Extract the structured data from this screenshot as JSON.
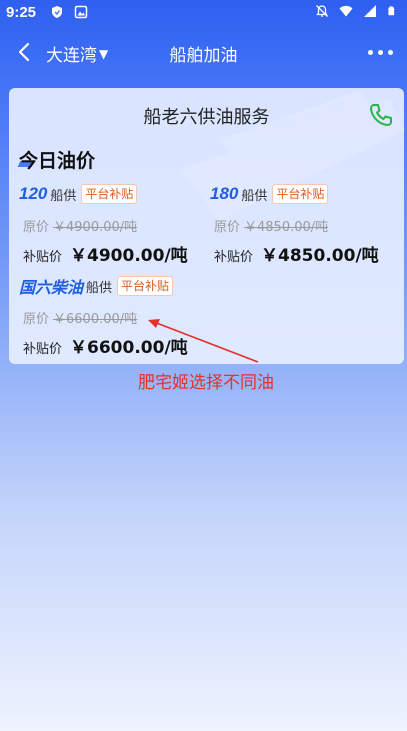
{
  "status_bar": {
    "time": "9:25",
    "left_icons": [
      "shield-icon",
      "image-icon"
    ],
    "right_icons": [
      "notifications-off-icon",
      "wifi-icon",
      "signal-icon",
      "battery-icon"
    ]
  },
  "nav": {
    "location": "大连湾",
    "title": "船舶加油"
  },
  "card": {
    "title": "船老六供油服务",
    "section_title": "今日油价",
    "fuels": [
      {
        "name": "120",
        "supply": "船供",
        "badge": "平台补贴",
        "orig_label": "原价",
        "orig_value": "￥4900.00/吨",
        "sub_label": "补贴价",
        "sub_value": "￥4900.00/吨"
      },
      {
        "name": "180",
        "supply": "船供",
        "badge": "平台补贴",
        "orig_label": "原价",
        "orig_value": "￥4850.00/吨",
        "sub_label": "补贴价",
        "sub_value": "￥4850.00/吨"
      },
      {
        "name": "国六柴油",
        "supply": "船供",
        "badge": "平台补贴",
        "orig_label": "原价",
        "orig_value": "￥6600.00/吨",
        "sub_label": "补贴价",
        "sub_value": "￥6600.00/吨"
      }
    ]
  },
  "annotation": {
    "text": "肥宅姬选择不同油",
    "color": "#e5302c"
  },
  "colors": {
    "accent": "#1f5fe0",
    "badge": "#e05a1f",
    "phone": "#27b34a"
  }
}
